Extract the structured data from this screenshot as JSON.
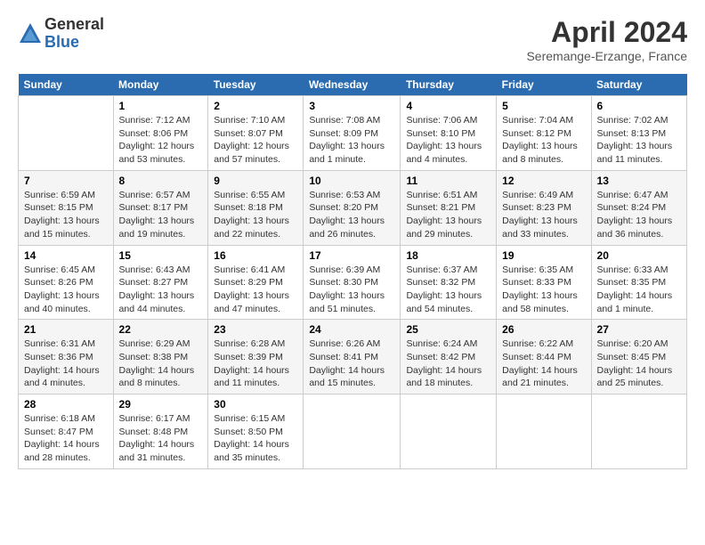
{
  "logo": {
    "general": "General",
    "blue": "Blue"
  },
  "header": {
    "month": "April 2024",
    "location": "Seremange-Erzange, France"
  },
  "days_of_week": [
    "Sunday",
    "Monday",
    "Tuesday",
    "Wednesday",
    "Thursday",
    "Friday",
    "Saturday"
  ],
  "weeks": [
    [
      {
        "day": "",
        "empty": true
      },
      {
        "day": "1",
        "sunrise": "Sunrise: 7:12 AM",
        "sunset": "Sunset: 8:06 PM",
        "daylight": "Daylight: 12 hours and 53 minutes."
      },
      {
        "day": "2",
        "sunrise": "Sunrise: 7:10 AM",
        "sunset": "Sunset: 8:07 PM",
        "daylight": "Daylight: 12 hours and 57 minutes."
      },
      {
        "day": "3",
        "sunrise": "Sunrise: 7:08 AM",
        "sunset": "Sunset: 8:09 PM",
        "daylight": "Daylight: 13 hours and 1 minute."
      },
      {
        "day": "4",
        "sunrise": "Sunrise: 7:06 AM",
        "sunset": "Sunset: 8:10 PM",
        "daylight": "Daylight: 13 hours and 4 minutes."
      },
      {
        "day": "5",
        "sunrise": "Sunrise: 7:04 AM",
        "sunset": "Sunset: 8:12 PM",
        "daylight": "Daylight: 13 hours and 8 minutes."
      },
      {
        "day": "6",
        "sunrise": "Sunrise: 7:02 AM",
        "sunset": "Sunset: 8:13 PM",
        "daylight": "Daylight: 13 hours and 11 minutes."
      }
    ],
    [
      {
        "day": "7",
        "sunrise": "Sunrise: 6:59 AM",
        "sunset": "Sunset: 8:15 PM",
        "daylight": "Daylight: 13 hours and 15 minutes."
      },
      {
        "day": "8",
        "sunrise": "Sunrise: 6:57 AM",
        "sunset": "Sunset: 8:17 PM",
        "daylight": "Daylight: 13 hours and 19 minutes."
      },
      {
        "day": "9",
        "sunrise": "Sunrise: 6:55 AM",
        "sunset": "Sunset: 8:18 PM",
        "daylight": "Daylight: 13 hours and 22 minutes."
      },
      {
        "day": "10",
        "sunrise": "Sunrise: 6:53 AM",
        "sunset": "Sunset: 8:20 PM",
        "daylight": "Daylight: 13 hours and 26 minutes."
      },
      {
        "day": "11",
        "sunrise": "Sunrise: 6:51 AM",
        "sunset": "Sunset: 8:21 PM",
        "daylight": "Daylight: 13 hours and 29 minutes."
      },
      {
        "day": "12",
        "sunrise": "Sunrise: 6:49 AM",
        "sunset": "Sunset: 8:23 PM",
        "daylight": "Daylight: 13 hours and 33 minutes."
      },
      {
        "day": "13",
        "sunrise": "Sunrise: 6:47 AM",
        "sunset": "Sunset: 8:24 PM",
        "daylight": "Daylight: 13 hours and 36 minutes."
      }
    ],
    [
      {
        "day": "14",
        "sunrise": "Sunrise: 6:45 AM",
        "sunset": "Sunset: 8:26 PM",
        "daylight": "Daylight: 13 hours and 40 minutes."
      },
      {
        "day": "15",
        "sunrise": "Sunrise: 6:43 AM",
        "sunset": "Sunset: 8:27 PM",
        "daylight": "Daylight: 13 hours and 44 minutes."
      },
      {
        "day": "16",
        "sunrise": "Sunrise: 6:41 AM",
        "sunset": "Sunset: 8:29 PM",
        "daylight": "Daylight: 13 hours and 47 minutes."
      },
      {
        "day": "17",
        "sunrise": "Sunrise: 6:39 AM",
        "sunset": "Sunset: 8:30 PM",
        "daylight": "Daylight: 13 hours and 51 minutes."
      },
      {
        "day": "18",
        "sunrise": "Sunrise: 6:37 AM",
        "sunset": "Sunset: 8:32 PM",
        "daylight": "Daylight: 13 hours and 54 minutes."
      },
      {
        "day": "19",
        "sunrise": "Sunrise: 6:35 AM",
        "sunset": "Sunset: 8:33 PM",
        "daylight": "Daylight: 13 hours and 58 minutes."
      },
      {
        "day": "20",
        "sunrise": "Sunrise: 6:33 AM",
        "sunset": "Sunset: 8:35 PM",
        "daylight": "Daylight: 14 hours and 1 minute."
      }
    ],
    [
      {
        "day": "21",
        "sunrise": "Sunrise: 6:31 AM",
        "sunset": "Sunset: 8:36 PM",
        "daylight": "Daylight: 14 hours and 4 minutes."
      },
      {
        "day": "22",
        "sunrise": "Sunrise: 6:29 AM",
        "sunset": "Sunset: 8:38 PM",
        "daylight": "Daylight: 14 hours and 8 minutes."
      },
      {
        "day": "23",
        "sunrise": "Sunrise: 6:28 AM",
        "sunset": "Sunset: 8:39 PM",
        "daylight": "Daylight: 14 hours and 11 minutes."
      },
      {
        "day": "24",
        "sunrise": "Sunrise: 6:26 AM",
        "sunset": "Sunset: 8:41 PM",
        "daylight": "Daylight: 14 hours and 15 minutes."
      },
      {
        "day": "25",
        "sunrise": "Sunrise: 6:24 AM",
        "sunset": "Sunset: 8:42 PM",
        "daylight": "Daylight: 14 hours and 18 minutes."
      },
      {
        "day": "26",
        "sunrise": "Sunrise: 6:22 AM",
        "sunset": "Sunset: 8:44 PM",
        "daylight": "Daylight: 14 hours and 21 minutes."
      },
      {
        "day": "27",
        "sunrise": "Sunrise: 6:20 AM",
        "sunset": "Sunset: 8:45 PM",
        "daylight": "Daylight: 14 hours and 25 minutes."
      }
    ],
    [
      {
        "day": "28",
        "sunrise": "Sunrise: 6:18 AM",
        "sunset": "Sunset: 8:47 PM",
        "daylight": "Daylight: 14 hours and 28 minutes."
      },
      {
        "day": "29",
        "sunrise": "Sunrise: 6:17 AM",
        "sunset": "Sunset: 8:48 PM",
        "daylight": "Daylight: 14 hours and 31 minutes."
      },
      {
        "day": "30",
        "sunrise": "Sunrise: 6:15 AM",
        "sunset": "Sunset: 8:50 PM",
        "daylight": "Daylight: 14 hours and 35 minutes."
      },
      {
        "day": "",
        "empty": true
      },
      {
        "day": "",
        "empty": true
      },
      {
        "day": "",
        "empty": true
      },
      {
        "day": "",
        "empty": true
      }
    ]
  ]
}
